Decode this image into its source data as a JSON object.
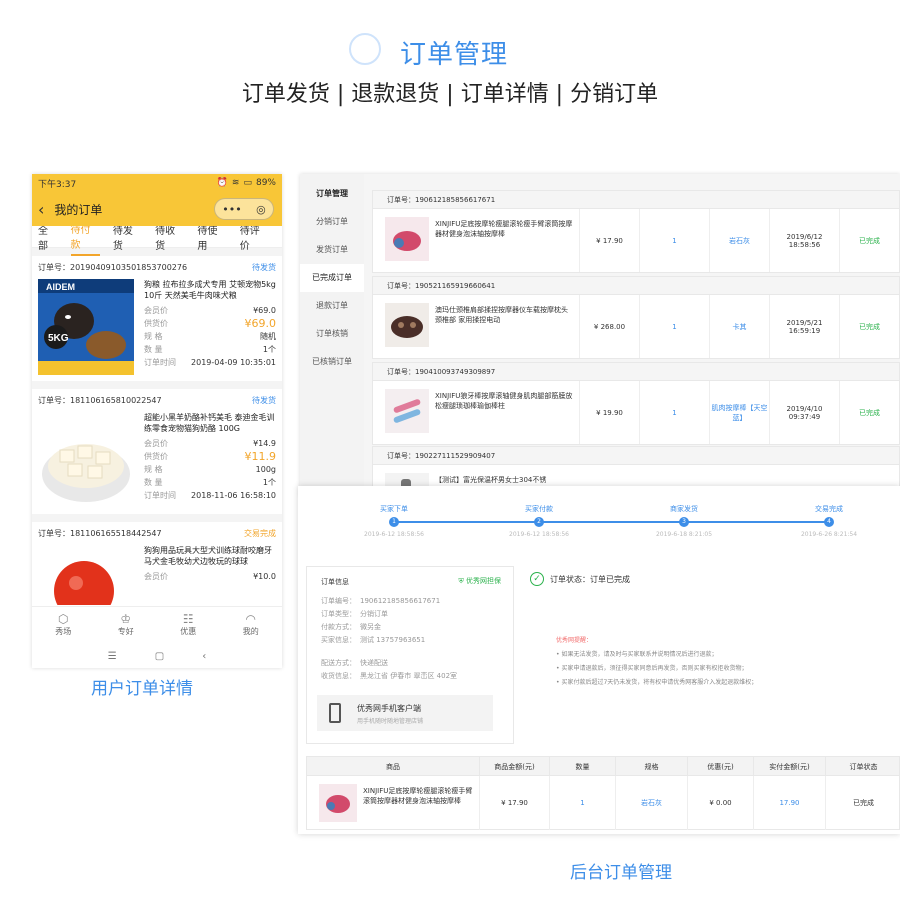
{
  "header": {
    "title": "订单管理",
    "subtitle": "订单发货 | 退款退货 | 订单详情 | 分销订单"
  },
  "phone": {
    "status_time": "下午3:37",
    "status_battery": "89%",
    "nav_title": "我的订单",
    "tabs": [
      "全部",
      "待付款",
      "待发货",
      "待收货",
      "待使用",
      "待评价"
    ],
    "active_tab": "待付款",
    "orders": [
      {
        "order_no_label": "订单号：20190409103501853700276",
        "status": "待发货",
        "name": "狗粮 拉布拉多成犬专用 艾顿宠物5kg 10斤 天然美毛牛肉味犬粮",
        "fields": [
          {
            "k": "会员价",
            "v": "¥69.0"
          },
          {
            "k": "供货价",
            "v": "¥69.0"
          },
          {
            "k": "规 格",
            "v": "随机"
          },
          {
            "k": "数 量",
            "v": "1个"
          },
          {
            "k": "订单时间",
            "v": "2019-04-09 10:35:01"
          }
        ],
        "brand": "AIDEM",
        "weight": "5KG"
      },
      {
        "order_no_label": "订单号：181106165810022547",
        "status": "待发货",
        "name": "超能小黑羊奶酪补钙美毛 泰迪金毛训练零食宠物猫狗奶酪 100G",
        "fields": [
          {
            "k": "会员价",
            "v": "¥14.9"
          },
          {
            "k": "供货价",
            "v": "¥11.9"
          },
          {
            "k": "规 格",
            "v": "100g"
          },
          {
            "k": "数 量",
            "v": "1个"
          },
          {
            "k": "订单时间",
            "v": "2018-11-06 16:58:10"
          }
        ]
      },
      {
        "order_no_label": "订单号：181106165518442547",
        "status": "交易完成",
        "name": "狗狗用品玩具大型犬训练球耐咬磨牙马犬金毛牧幼犬边牧玩的球球",
        "fields": [
          {
            "k": "会员价",
            "v": "¥10.0"
          }
        ]
      }
    ],
    "bottom_nav": [
      {
        "icon": "⬡",
        "label": "秀场"
      },
      {
        "icon": "♔",
        "label": "专好"
      },
      {
        "icon": "☷",
        "label": "优惠"
      },
      {
        "icon": "◠",
        "label": "我的"
      }
    ],
    "sys_keys": [
      "☰",
      "▢",
      "‹"
    ]
  },
  "caption_user": "用户订单详情",
  "admin": {
    "sidebar": [
      "订单管理",
      "分销订单",
      "发货订单",
      "已完成订单",
      "退款订单",
      "订单核销",
      "已核销订单"
    ],
    "orders": [
      {
        "no": "订单号：190612185856617671",
        "name": "XINJIFU足底按摩轮瘦腿滚轮瘦手臂滚筒按摩器材健身泡沫轴按摩棒",
        "price": "¥ 17.90",
        "qty": "1",
        "spec": "岩石灰",
        "time": "2019/6/12 18:58:56",
        "status": "已完成"
      },
      {
        "no": "订单号：190521165919660641",
        "name": "澳玛仕颈椎肩部揉捏按摩器仪车载按摩枕头颈椎部 家用揉捏电动",
        "price": "¥ 268.00",
        "qty": "1",
        "spec": "卡其",
        "time": "2019/5/21 16:59:19",
        "status": "已完成"
      },
      {
        "no": "订单号：190410093749309897",
        "name": "XINJIFU狼牙棒按摩滚轴健身肌肉腿部筋膜放松瘦腿琐珈棒瑜伽棒柱",
        "price": "¥ 19.90",
        "qty": "1",
        "spec": "肌肉按摩棒【天空蓝】",
        "time": "2019/4/10 09:37:49",
        "status": "已完成"
      },
      {
        "no": "订单号：190227111529909407",
        "name": "【测试】富光保温杯男女士304不锈"
      }
    ]
  },
  "detail": {
    "steps": [
      {
        "label": "买家下单",
        "num": "1",
        "time": "2019-6-12 18:58:56"
      },
      {
        "label": "买家付款",
        "num": "2",
        "time": "2019-6-12 18:58:56"
      },
      {
        "label": "商家发货",
        "num": "3",
        "time": "2019-6-18 8:21:05"
      },
      {
        "label": "交易完成",
        "num": "4",
        "time": "2019-6-26 8:21:54"
      }
    ],
    "info_title": "订单信息",
    "info_badge": "优秀网担保",
    "info_rows": [
      {
        "k": "订单编号：",
        "v": "190612185856617671"
      },
      {
        "k": "订单类型：",
        "v": "分销订单"
      },
      {
        "k": "付款方式：",
        "v": "微另金"
      },
      {
        "k": "买家信息：",
        "v": "测试 13757963651"
      },
      {
        "k": "",
        "v": ""
      },
      {
        "k": "配送方式：",
        "v": "快递配送"
      },
      {
        "k": "收货信息：",
        "v": "黑龙江省 伊春市 翠峦区 402室"
      }
    ],
    "app_title": "优秀网手机客户端",
    "app_sub": "用手机随时随地管理店铺",
    "status_text": "订单状态：订单已完成",
    "tips_head": "优秀网提醒：",
    "tips": [
      "• 如果无法发货，请及时与买家联系并说明情况后进行退款；",
      "• 买家申请退款后，须征得买家同意后再发货，否则买家有权拒收货物；",
      "• 买家付款后超过7天仍未发货，将有权申请优秀网客服介入发起退款维权；"
    ],
    "table_head": [
      "商品",
      "商品金额(元)",
      "数量",
      "规格",
      "优惠(元)",
      "实付金额(元)",
      "订单状态"
    ],
    "table_row": {
      "name": "XINJIFU足底按摩轮瘦腿滚轮瘦手臂滚筒按摩器材健身泡沫轴按摩棒",
      "amount": "¥ 17.90",
      "qty": "1",
      "spec": "岩石灰",
      "discount": "¥ 0.00",
      "paid": "17.90",
      "status": "已完成"
    }
  },
  "caption_admin": "后台订单管理"
}
